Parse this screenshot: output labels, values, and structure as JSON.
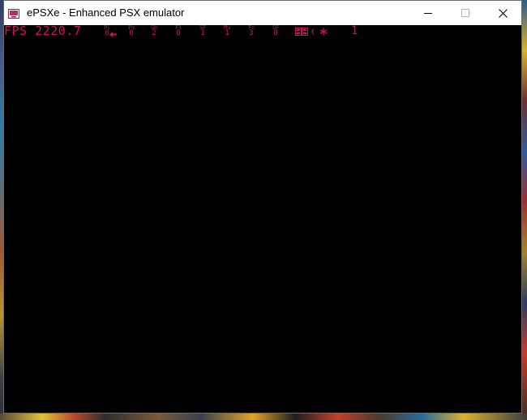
{
  "window": {
    "title": "ePSXe - Enhanced PSX emulator",
    "controls": {
      "minimize_icon": "minimize-icon",
      "maximize_icon": "maximize-icon",
      "close_icon": "close-icon"
    }
  },
  "hud": {
    "fps": "FPS 2220.7",
    "stats": [
      {
        "label": "Pl",
        "value": "0"
      },
      {
        "label": "Ps",
        "value": "0"
      },
      {
        "label": "Gb",
        "value": "2"
      },
      {
        "label": "Fl",
        "value": "0"
      },
      {
        "label": "SF",
        "value": "1"
      },
      {
        "label": "Mu",
        "value": "1"
      },
      {
        "label": "Fc",
        "value": "3"
      },
      {
        "label": "GF",
        "value": "0"
      }
    ],
    "number": "1",
    "color": "#d01060"
  },
  "colors": {
    "screen": "#000000",
    "titlebar": "#ffffff"
  }
}
